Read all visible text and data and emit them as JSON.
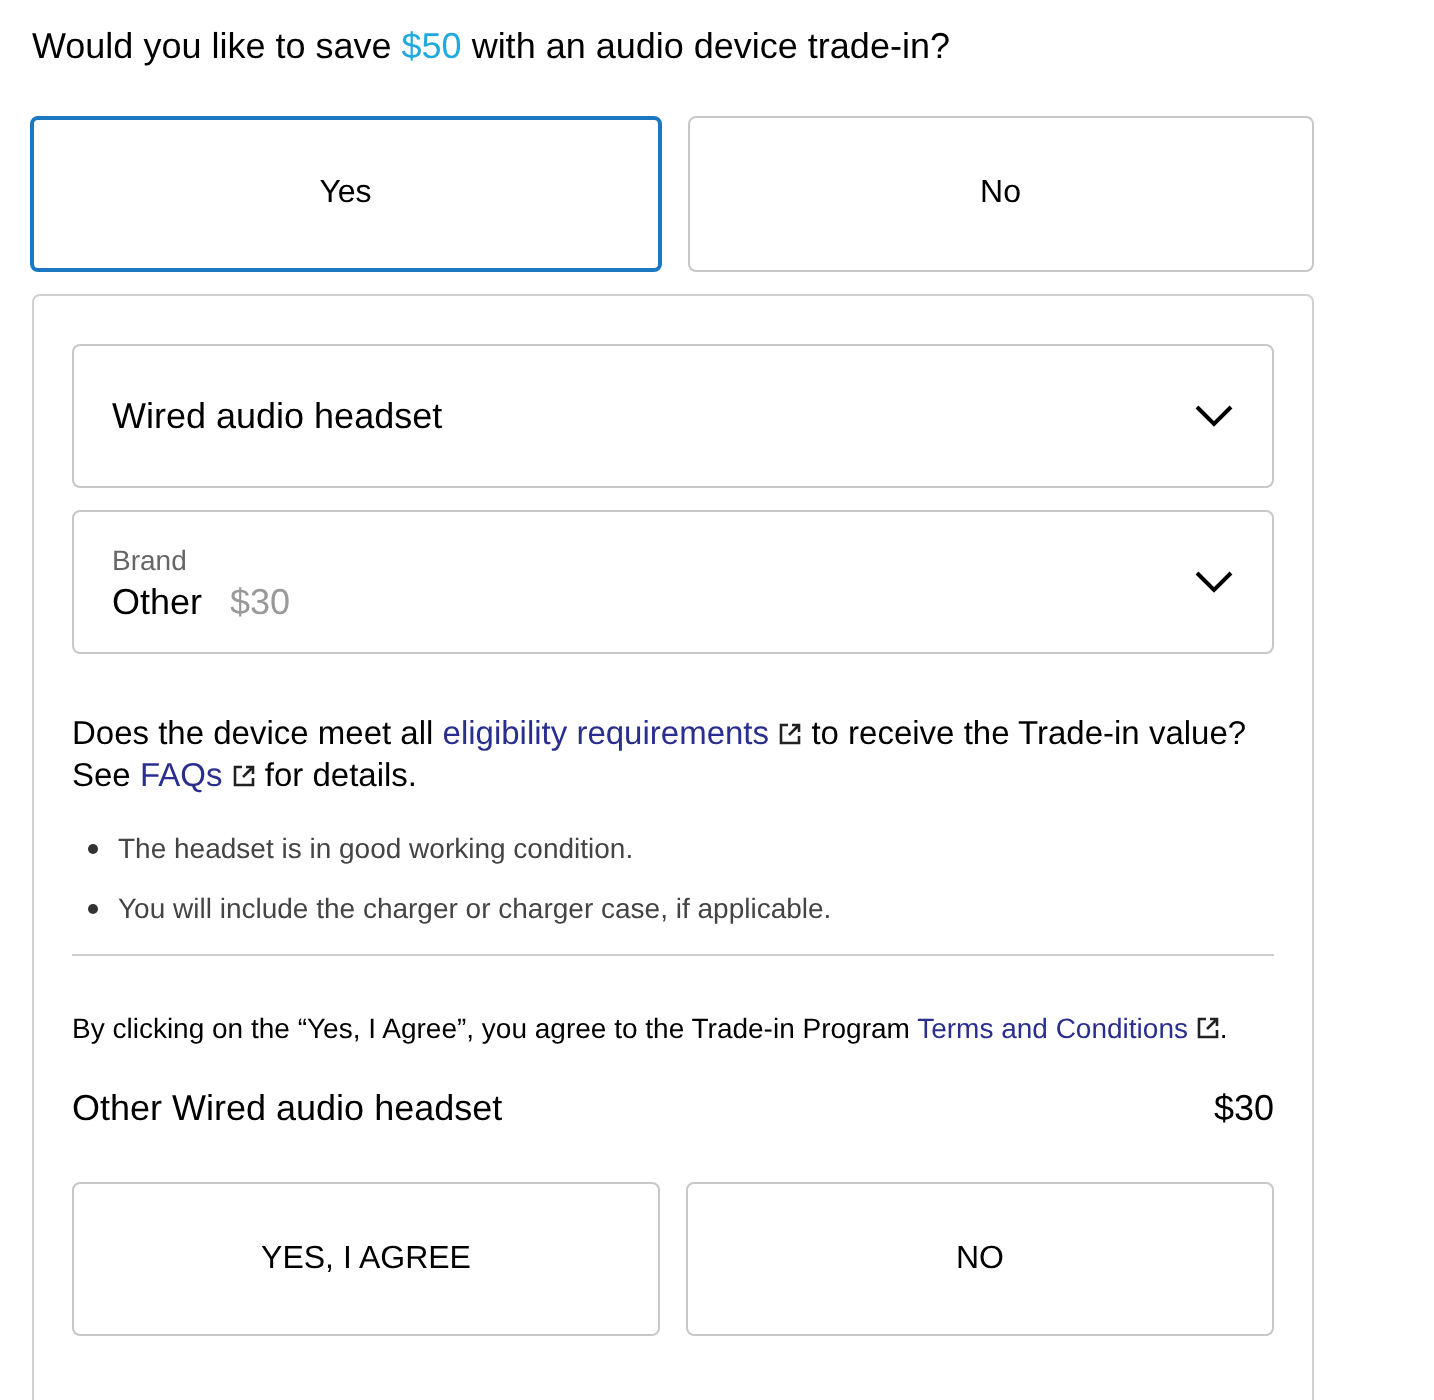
{
  "heading": {
    "parts": [
      {
        "kind": "text",
        "text": "Would you like to save "
      },
      {
        "kind": "highlight",
        "text": "$50"
      },
      {
        "kind": "text",
        "text": " with an audio device trade-in?"
      }
    ]
  },
  "trade_in_options": [
    {
      "label": "Yes",
      "selected": true
    },
    {
      "label": "No",
      "selected": false
    }
  ],
  "device_type": {
    "value": "Wired audio headset"
  },
  "brand": {
    "label": "Brand",
    "value": "Other",
    "price": "$30"
  },
  "eligibility": {
    "parts": [
      {
        "kind": "text",
        "text": "Does the device meet all "
      },
      {
        "kind": "link",
        "text": "eligibility requirements"
      },
      {
        "kind": "text",
        "text": " to receive the Trade-in value? See "
      },
      {
        "kind": "link",
        "text": "FAQs"
      },
      {
        "kind": "text",
        "text": " for details."
      }
    ]
  },
  "conditions": [
    "The headset is in good working condition.",
    "You will include the charger or charger case, if applicable."
  ],
  "terms": {
    "parts": [
      {
        "kind": "text",
        "text": "By clicking on the “Yes, I Agree”, you agree to the Trade-in Program "
      },
      {
        "kind": "link",
        "text": "Terms and Conditions"
      },
      {
        "kind": "text",
        "text": "."
      }
    ]
  },
  "summary": {
    "item": "Other Wired audio headset",
    "price": "$30"
  },
  "agreement_buttons": [
    "YES, I AGREE",
    "NO"
  ]
}
